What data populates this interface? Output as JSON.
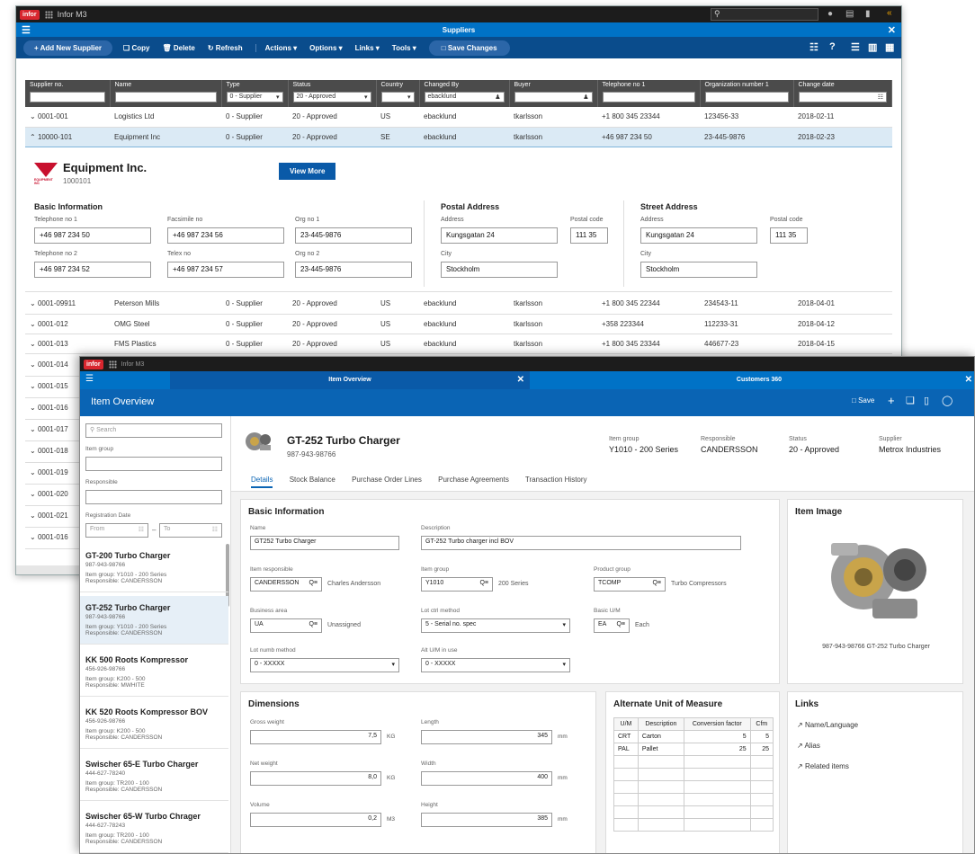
{
  "win1": {
    "logo": "infor",
    "app": "Infor M3",
    "title": "Suppliers",
    "toolbar": {
      "add": "+ Add New Supplier",
      "copy": "Copy",
      "delete": "Delete",
      "refresh": "Refresh",
      "actions": "Actions ▾",
      "options": "Options ▾",
      "links": "Links ▾",
      "tools": "Tools ▾",
      "save": "Save Changes"
    },
    "columns": [
      "Supplier no.",
      "Name",
      "Type",
      "Status",
      "Country",
      "Changed By",
      "Buyer",
      "Telephone no 1",
      "Organization number 1",
      "Change date"
    ],
    "filters": {
      "type": "0 - Supplier",
      "status": "20 - Approved",
      "changed_by": "ebacklund"
    },
    "rows": [
      {
        "no": "0001-001",
        "name": "Logistics Ltd",
        "type": "0 - Supplier",
        "status": "20 - Approved",
        "country": "US",
        "changed": "ebacklund",
        "buyer": "tkarlsson",
        "tel": "+1 800 345 23344",
        "org": "123456-33",
        "date": "2018-02-11"
      },
      {
        "no": "10000-101",
        "name": "Equipment Inc",
        "type": "0 - Supplier",
        "status": "20 - Approved",
        "country": "SE",
        "changed": "ebacklund",
        "buyer": "tkarlsson",
        "tel": "+46 987 234 50",
        "org": "23-445-9876",
        "date": "2018-02-23"
      },
      {
        "no": "0001-09911",
        "name": "Peterson Mills",
        "type": "0 - Supplier",
        "status": "20 - Approved",
        "country": "US",
        "changed": "ebacklund",
        "buyer": "tkarlsson",
        "tel": "+1 800 345 22344",
        "org": "234543-11",
        "date": "2018-04-01"
      },
      {
        "no": "0001-012",
        "name": "OMG Steel",
        "type": "0 - Supplier",
        "status": "20 - Approved",
        "country": "US",
        "changed": "ebacklund",
        "buyer": "tkarlsson",
        "tel": "+358 223344",
        "org": "112233-31",
        "date": "2018-04-12"
      },
      {
        "no": "0001-013",
        "name": "FMS Plastics",
        "type": "0 - Supplier",
        "status": "20 - Approved",
        "country": "US",
        "changed": "ebacklund",
        "buyer": "tkarlsson",
        "tel": "+1 800 345 23344",
        "org": "446677-23",
        "date": "2018-04-15"
      }
    ],
    "more_rows": [
      "0001-014",
      "0001-015",
      "0001-016",
      "0001-017",
      "0001-018",
      "0001-019",
      "0001-020",
      "0001-021",
      "0001-016"
    ],
    "detail": {
      "company": "Equipment Inc.",
      "number": "1000101",
      "logo_text": "EQUIPMENT INC",
      "view_more": "View More",
      "basic": "Basic Information",
      "postal": "Postal Address",
      "street": "Street Address",
      "tel1_l": "Telephone no 1",
      "tel1": "+46 987 234 50",
      "fax_l": "Facsimile no",
      "fax": "+46 987 234 56",
      "org1_l": "Org no 1",
      "org1": "23-445-9876",
      "tel2_l": "Telephone no 2",
      "tel2": "+46 987 234 52",
      "telex_l": "Telex no",
      "telex": "+46 987 234 57",
      "org2_l": "Org no 2",
      "org2": "23-445-9876",
      "addr_l": "Address",
      "addr": "Kungsgatan 24",
      "pc_l": "Postal code",
      "pc": "111 35",
      "city_l": "City",
      "city": "Stockholm"
    }
  },
  "win2": {
    "logo": "infor",
    "app": "Infor M3",
    "tab1": "Item Overview",
    "tab2": "Customers 360",
    "title": "Item Overview",
    "save": "Save",
    "side": {
      "search": "Search",
      "item_group": "Item group",
      "responsible": "Responsible",
      "reg_date": "Registration Date",
      "from": "From",
      "to": "To",
      "items": [
        {
          "t": "GT-200 Turbo Charger",
          "n": "987-943-98766",
          "g": "Item group: Y1010 - 200 Series",
          "r": "Responsible: CANDERSSON"
        },
        {
          "t": "GT-252 Turbo Charger",
          "n": "987-943-98766",
          "g": "Item group: Y1010 - 200 Series",
          "r": "Responsible: CANDERSSON"
        },
        {
          "t": "KK 500 Roots Kompressor",
          "n": "456-926-98766",
          "g": "Item group: K200 - 500",
          "r": "Responsible: MWHITE"
        },
        {
          "t": "KK 520 Roots Kompressor BOV",
          "n": "456-926-98766",
          "g": "Item group: K200 - 500",
          "r": "Responsible: CANDERSSON"
        },
        {
          "t": "Swischer 65-E Turbo Charger",
          "n": "444-627-78240",
          "g": "Item group: TR200 - 100",
          "r": "Responsible: CANDERSSON"
        },
        {
          "t": "Swischer 65-W Turbo Chrager",
          "n": "444-627-78243",
          "g": "Item group: TR200 - 100",
          "r": "Responsible: CANDERSSON"
        }
      ]
    },
    "header": {
      "name": "GT-252 Turbo Charger",
      "number": "987-943-98766",
      "ig_l": "Item group",
      "ig": "Y1010 - 200 Series",
      "resp_l": "Responsible",
      "resp": "CANDERSSON",
      "status_l": "Status",
      "status": "20 - Approved",
      "sup_l": "Supplier",
      "sup": "Metrox Industries"
    },
    "tabs": [
      "Details",
      "Stock Balance",
      "Purchase Order Lines",
      "Purchase Agreements",
      "Transaction History"
    ],
    "basic": {
      "title": "Basic Information",
      "name_l": "Name",
      "name": "GT252 Turbo Charger",
      "desc_l": "Description",
      "desc": "GT-252 Turbo charger incl BOV",
      "resp_l": "Item responsible",
      "resp": "CANDERSSON",
      "resp_d": "Charles Andersson",
      "ig_l": "Item group",
      "ig": "Y1010",
      "ig_d": "200 Series",
      "pg_l": "Product group",
      "pg": "TCOMP",
      "pg_d": "Turbo Compressors",
      "ba_l": "Business area",
      "ba": "UA",
      "ba_d": "Unassigned",
      "lot_l": "Lot ctrl method",
      "lot": "5 - Serial no. spec",
      "um_l": "Basic U/M",
      "um": "EA",
      "um_d": "Each",
      "lnm_l": "Lot numb method",
      "lnm": "0 - XXXXX",
      "alt_l": "Alt U/M in use",
      "alt": "0 - XXXXX"
    },
    "image": {
      "title": "Item Image",
      "caption": "987-943-98766 GT-252 Turbo Charger"
    },
    "dim": {
      "title": "Dimensions",
      "gw_l": "Gross weight",
      "gw": "7,5",
      "gw_u": "KG",
      "len_l": "Length",
      "len": "345",
      "len_u": "mm",
      "nw_l": "Net weight",
      "nw": "8,0",
      "nw_u": "KG",
      "wid_l": "Width",
      "wid": "400",
      "wid_u": "mm",
      "vol_l": "Volume",
      "vol": "0,2",
      "vol_u": "M3",
      "hei_l": "Height",
      "hei": "385",
      "hei_u": "mm"
    },
    "aum": {
      "title": "Alternate Unit of Measure",
      "cols": [
        "U/M",
        "Description",
        "Conversion factor",
        "Cfm"
      ],
      "rows": [
        [
          "CRT",
          "Carton",
          "5",
          "5"
        ],
        [
          "PAL",
          "Pallet",
          "25",
          "25"
        ]
      ]
    },
    "links": {
      "title": "Links",
      "items": [
        "Name/Language",
        "Alias",
        "Related items"
      ]
    }
  }
}
